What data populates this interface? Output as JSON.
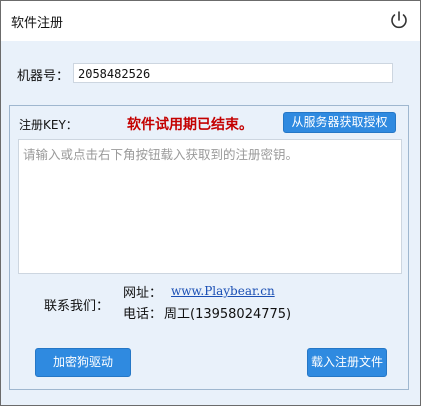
{
  "window": {
    "title": "软件注册"
  },
  "machine": {
    "label": "机器号：",
    "value": "2058482526"
  },
  "register": {
    "key_label": "注册KEY：",
    "expired_text": "软件试用期已结束。",
    "server_button": "从服务器获取授权",
    "placeholder": "请输入或点击右下角按钮载入获取到的注册密钥。"
  },
  "contact": {
    "label": "联系我们：",
    "site_label": "网址：",
    "site_url": "www.Playbear.cn",
    "phone_label": "电话：",
    "phone_value": "周工(13958024775)"
  },
  "buttons": {
    "driver": "加密狗驱动",
    "load_file": "载入注册文件"
  },
  "icons": {
    "power": "power-icon"
  },
  "colors": {
    "accent": "#2f8ae0",
    "warning": "#c40000",
    "background": "#e9f1fa"
  }
}
